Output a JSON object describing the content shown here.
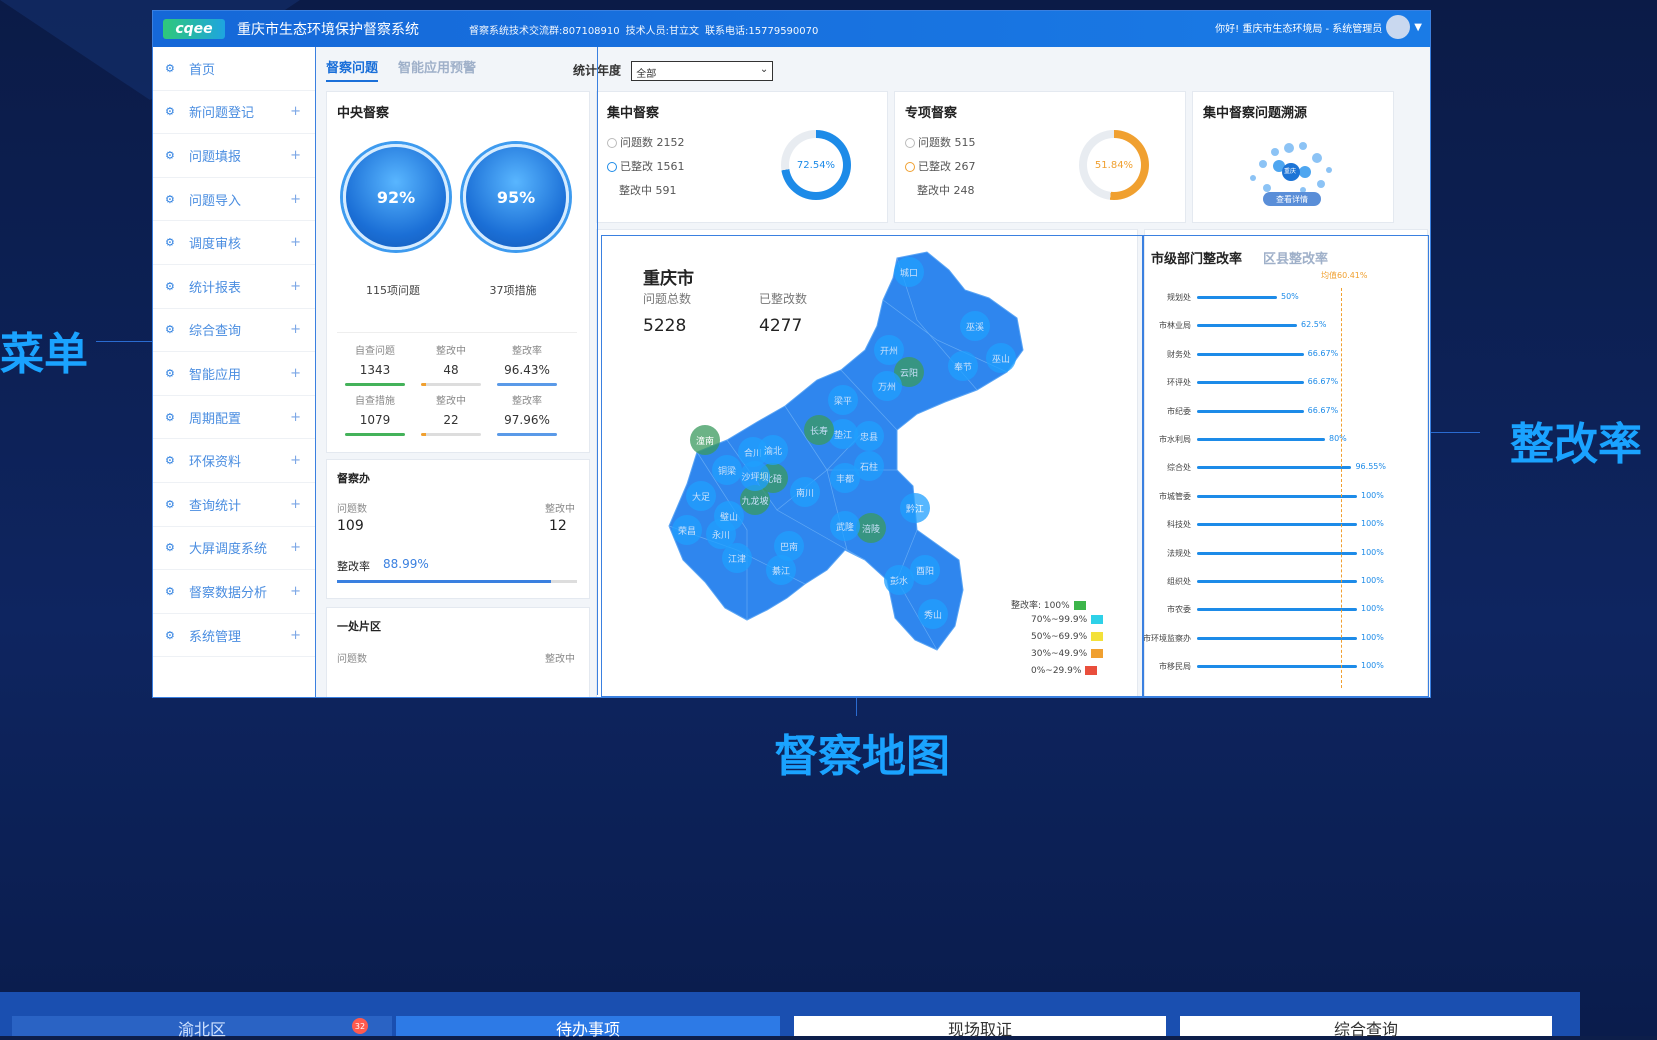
{
  "header": {
    "logo": "cqee",
    "title": "重庆市生态环境保护督察系统",
    "info1": "督察系统技术交流群:807108910",
    "info2": "技术人员:甘立文",
    "info3": "联系电话:15779590070",
    "user_greeting": "你好! 重庆市生态环境局 - 系统管理员"
  },
  "annotations": {
    "left": "菜单",
    "right": "整改率",
    "bottom": "督察地图"
  },
  "sidebar": {
    "items": [
      {
        "label": "首页",
        "expandable": false
      },
      {
        "label": "新问题登记",
        "expandable": true
      },
      {
        "label": "问题填报",
        "expandable": true
      },
      {
        "label": "问题导入",
        "expandable": true
      },
      {
        "label": "调度审核",
        "expandable": true
      },
      {
        "label": "统计报表",
        "expandable": true
      },
      {
        "label": "综合查询",
        "expandable": true
      },
      {
        "label": "智能应用",
        "expandable": true
      },
      {
        "label": "周期配置",
        "expandable": true
      },
      {
        "label": "环保资料",
        "expandable": true
      },
      {
        "label": "查询统计",
        "expandable": true
      },
      {
        "label": "大屏调度系统",
        "expandable": true
      },
      {
        "label": "督察数据分析",
        "expandable": true
      },
      {
        "label": "系统管理",
        "expandable": true
      }
    ],
    "plus": "+",
    "gear": "⚙"
  },
  "tabs": [
    {
      "label": "督察问题",
      "active": true
    },
    {
      "label": "智能应用预警",
      "active": false
    }
  ],
  "year_filter": {
    "label": "统计年度",
    "value": "全部"
  },
  "central": {
    "title": "中央督察",
    "bubble1": {
      "value": "92%",
      "caption": "115项问题"
    },
    "bubble2": {
      "value": "95%",
      "caption": "37项措施"
    },
    "row1": {
      "l1": "自查问题",
      "v1": "1343",
      "l2": "整改中",
      "v2": "48",
      "l3": "整改率",
      "v3": "96.43%"
    },
    "row2": {
      "l1": "自查措施",
      "v1": "1079",
      "l2": "整改中",
      "v2": "22",
      "l3": "整改率",
      "v3": "97.96%"
    }
  },
  "office": {
    "title": "督察办",
    "count_label": "问题数",
    "count": "109",
    "fixing_label": "整改中",
    "fixing": "12",
    "rate_label": "整改率",
    "rate": "88.99%",
    "rate_value": 0.8899
  },
  "district1": {
    "title": "一处片区",
    "count_label": "问题数",
    "fixing_label": "整改中"
  },
  "focus": {
    "title": "集中督察",
    "issues": "问题数 2152",
    "fixed": "已整改 1561",
    "fixing": "整改中 591",
    "rate": "72.54%",
    "rate_value": 72.54
  },
  "special": {
    "title": "专项督察",
    "issues": "问题数 515",
    "fixed": "已整改 267",
    "fixing": "整改中 248",
    "rate": "51.84%",
    "rate_value": 51.84
  },
  "trace": {
    "title": "集中督察问题溯源",
    "center": "重庆",
    "button": "查看详情"
  },
  "map": {
    "title": "重庆市",
    "total_label": "问题总数",
    "total": "5228",
    "fixed_label": "已整改数",
    "fixed": "4277",
    "districts": [
      "城口",
      "巫溪",
      "开州",
      "云阳",
      "奉节",
      "巫山",
      "万州",
      "梁平",
      "垫江",
      "忠县",
      "石柱",
      "长寿",
      "涪陵",
      "丰都",
      "武隆",
      "彭水",
      "黔江",
      "酉阳",
      "秀山",
      "南川",
      "綦江",
      "江津",
      "永川",
      "大足",
      "荣昌",
      "潼南",
      "铜梁",
      "合川",
      "璧山",
      "北碚",
      "渝北",
      "巴南",
      "九龙坡",
      "沙坪坝"
    ],
    "legend": [
      {
        "label": "整改率: 100%",
        "color": "#3cb54a"
      },
      {
        "label": "70%~99.9%",
        "color": "#2ed1e8"
      },
      {
        "label": "50%~69.9%",
        "color": "#f3e13a"
      },
      {
        "label": "30%~49.9%",
        "color": "#f0a030"
      },
      {
        "label": "0%~29.9%",
        "color": "#e94e3c"
      }
    ]
  },
  "rates": {
    "tab_active": "市级部门整改率",
    "tab_other": "区县整改率",
    "avg_label": "均值60.41%",
    "items": [
      {
        "name": "规划处",
        "value": 50,
        "label": "50%"
      },
      {
        "name": "市林业局",
        "value": 62.5,
        "label": "62.5%"
      },
      {
        "name": "财务处",
        "value": 66.67,
        "label": "66.67%"
      },
      {
        "name": "环评处",
        "value": 66.67,
        "label": "66.67%"
      },
      {
        "name": "市纪委",
        "value": 66.67,
        "label": "66.67%"
      },
      {
        "name": "市水利局",
        "value": 80,
        "label": "80%"
      },
      {
        "name": "综合处",
        "value": 96.55,
        "label": "96.55%"
      },
      {
        "name": "市城管委",
        "value": 100,
        "label": "100%"
      },
      {
        "name": "科技处",
        "value": 100,
        "label": "100%"
      },
      {
        "name": "法规处",
        "value": 100,
        "label": "100%"
      },
      {
        "name": "组织处",
        "value": 100,
        "label": "100%"
      },
      {
        "name": "市农委",
        "value": 100,
        "label": "100%"
      },
      {
        "name": "市环境监察办",
        "value": 100,
        "label": "100%"
      },
      {
        "name": "市移民局",
        "value": 100,
        "label": "100%"
      }
    ]
  },
  "bottom": {
    "card1": "渝北区",
    "card2": "待办事项",
    "card3": "现场取证",
    "card4": "综合查询",
    "badge": "32"
  }
}
